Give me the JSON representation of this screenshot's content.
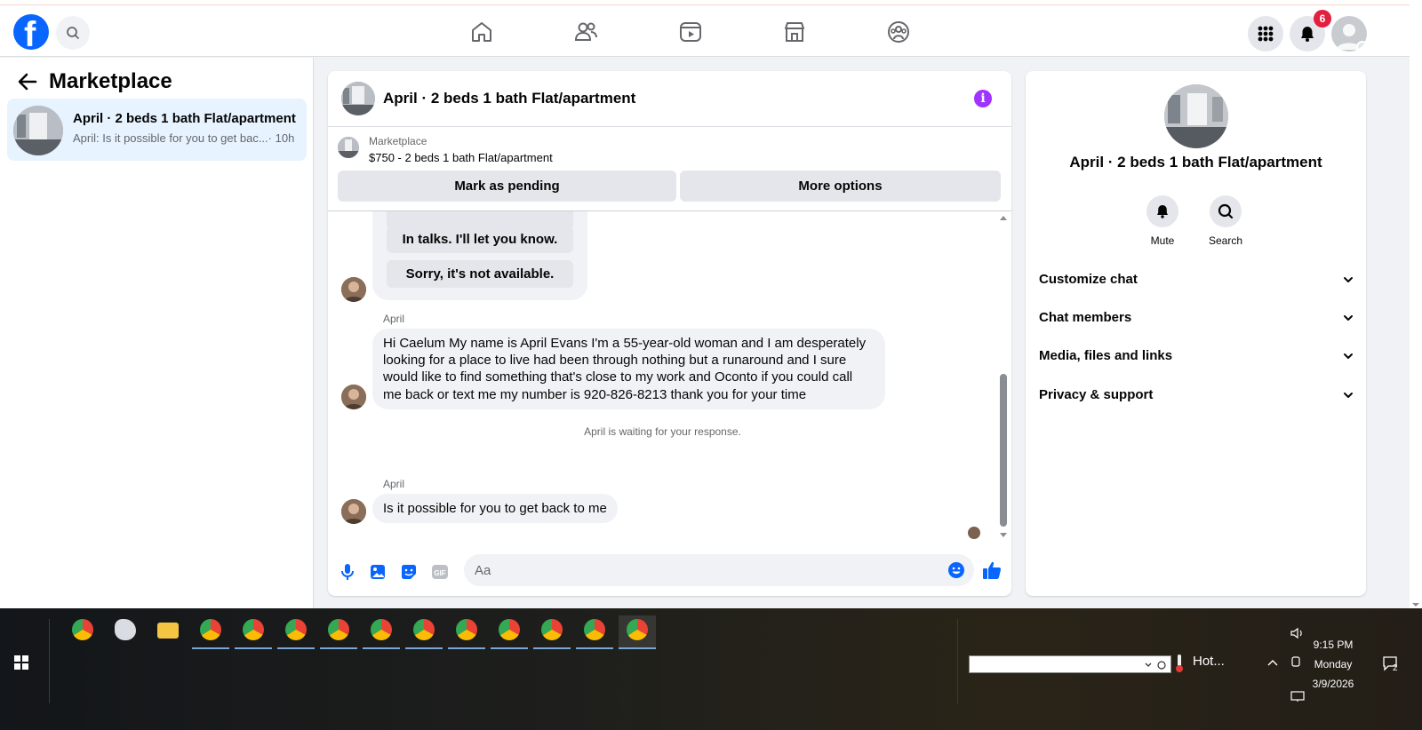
{
  "header": {
    "logo_letter": "f",
    "notifications_count": "6",
    "nav_icons": [
      "home-icon",
      "friends-icon",
      "video-icon",
      "marketplace-icon",
      "groups-icon"
    ]
  },
  "left_panel": {
    "title": "Marketplace",
    "conversations": [
      {
        "title": "April · 2 beds 1 bath Flat/apartment",
        "preview": "April: Is it possible for you to get bac...",
        "time": "· 10h"
      }
    ]
  },
  "chat": {
    "title": "April · 2 beds 1 bath Flat/apartment",
    "listing_source": "Marketplace",
    "listing_price": "$750 - 2 beds 1 bath Flat/apartment",
    "mark_pending_label": "Mark as pending",
    "more_options_label": "More options",
    "quick_replies": [
      "In talks. I'll let you know.",
      "Sorry, it's not available."
    ],
    "messages": [
      {
        "sender": "April",
        "text": "Hi Caelum My name is April Evans I'm a 55-year-old woman and I am desperately looking for a place to live had been through nothing but a runaround and I sure would like to find something that's close to my work and Oconto if you could call me back or text me my number is 920-826-8213 thank you for your time"
      },
      {
        "sender": "April",
        "text": "Is it possible for you to get back to me"
      }
    ],
    "status_message": "April is waiting for your response.",
    "composer_placeholder": "Aa"
  },
  "right_panel": {
    "title": "April · 2 beds 1 bath Flat/apartment",
    "actions": [
      {
        "label": "Mute",
        "icon": "bell-icon"
      },
      {
        "label": "Search",
        "icon": "search-icon"
      }
    ],
    "sections": [
      "Customize chat",
      "Chat members",
      "Media, files and links",
      "Privacy & support"
    ]
  },
  "taskbar": {
    "weather": "Hot...",
    "time": "9:15 PM",
    "day": "Monday",
    "date": "3/9/2026",
    "notification_count": "2"
  },
  "colors": {
    "brand": "#0866ff",
    "info": "#a033ff",
    "selected": "#e7f3ff",
    "badge": "#e41e3f"
  }
}
